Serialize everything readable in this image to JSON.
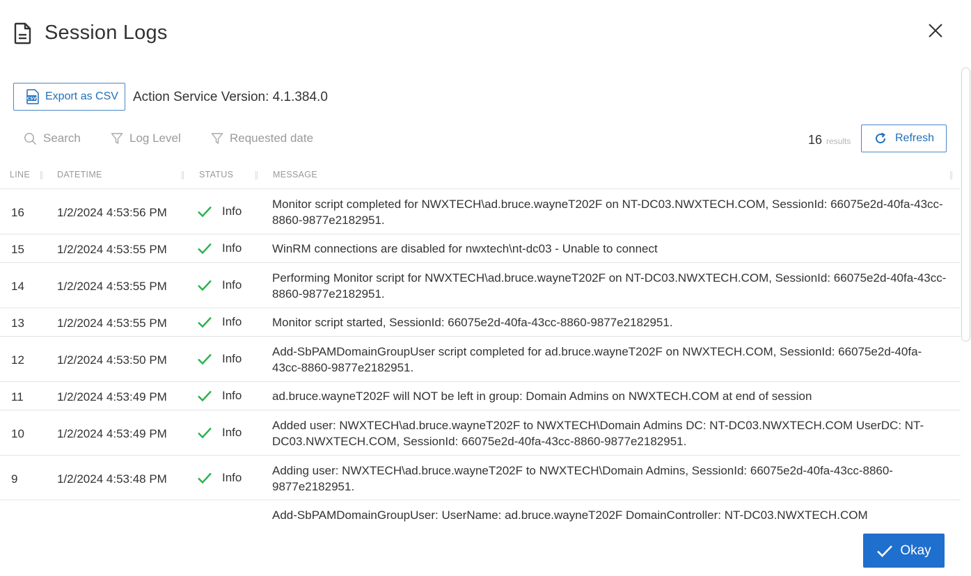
{
  "dialog": {
    "title": "Session Logs",
    "icons": {
      "title": "document-icon",
      "close": "close-icon"
    }
  },
  "toolbar": {
    "export_label": "Export as CSV",
    "export_icon": "csv-file-icon",
    "version_text": "Action Service Version: 4.1.384.0"
  },
  "filters": {
    "search_label": "Search",
    "log_level_label": "Log Level",
    "requested_date_label": "Requested date"
  },
  "results": {
    "count": "16",
    "label": "results",
    "refresh_label": "Refresh",
    "refresh_icon": "refresh-icon"
  },
  "table": {
    "columns": [
      "LINE",
      "DATETIME",
      "STATUS",
      "MESSAGE"
    ],
    "rows": [
      {
        "line": "16",
        "datetime": "1/2/2024 4:53:56 PM",
        "status": "Info",
        "message": "Monitor script completed for NWXTECH\\ad.bruce.wayneT202F on NT-DC03.NWXTECH.COM, SessionId: 66075e2d-40fa-43cc-8860-9877e2182951."
      },
      {
        "line": "15",
        "datetime": "1/2/2024 4:53:55 PM",
        "status": "Info",
        "message": "WinRM connections are disabled for nwxtech\\nt-dc03 - Unable to connect"
      },
      {
        "line": "14",
        "datetime": "1/2/2024 4:53:55 PM",
        "status": "Info",
        "message": "Performing Monitor script for NWXTECH\\ad.bruce.wayneT202F on NT-DC03.NWXTECH.COM, SessionId: 66075e2d-40fa-43cc-8860-9877e2182951."
      },
      {
        "line": "13",
        "datetime": "1/2/2024 4:53:55 PM",
        "status": "Info",
        "message": "Monitor script started, SessionId: 66075e2d-40fa-43cc-8860-9877e2182951."
      },
      {
        "line": "12",
        "datetime": "1/2/2024 4:53:50 PM",
        "status": "Info",
        "message": "Add-SbPAMDomainGroupUser script completed for ad.bruce.wayneT202F on NWXTECH.COM, SessionId: 66075e2d-40fa-43cc-8860-9877e2182951."
      },
      {
        "line": "11",
        "datetime": "1/2/2024 4:53:49 PM",
        "status": "Info",
        "message": "ad.bruce.wayneT202F will NOT be left in group: Domain Admins on NWXTECH.COM at end of session"
      },
      {
        "line": "10",
        "datetime": "1/2/2024 4:53:49 PM",
        "status": "Info",
        "message": "Added user: NWXTECH\\ad.bruce.wayneT202F to NWXTECH\\Domain Admins DC: NT-DC03.NWXTECH.COM UserDC: NT-DC03.NWXTECH.COM, SessionId: 66075e2d-40fa-43cc-8860-9877e2182951."
      },
      {
        "line": "9",
        "datetime": "1/2/2024 4:53:48 PM",
        "status": "Info",
        "message": "Adding user: NWXTECH\\ad.bruce.wayneT202F to NWXTECH\\Domain Admins, SessionId: 66075e2d-40fa-43cc-8860-9877e2182951."
      },
      {
        "line": "",
        "datetime": "",
        "status": "",
        "message": "Add-SbPAMDomainGroupUser: UserName: ad.bruce.wayneT202F DomainController: NT-DC03.NWXTECH.COM"
      }
    ]
  },
  "footer": {
    "okay_label": "Okay",
    "okay_icon": "check-icon"
  },
  "colors": {
    "accent": "#1f6fce",
    "link_blue": "#1f6fb8",
    "success_green": "#2bb24c",
    "muted_text": "#9a9a9a"
  }
}
